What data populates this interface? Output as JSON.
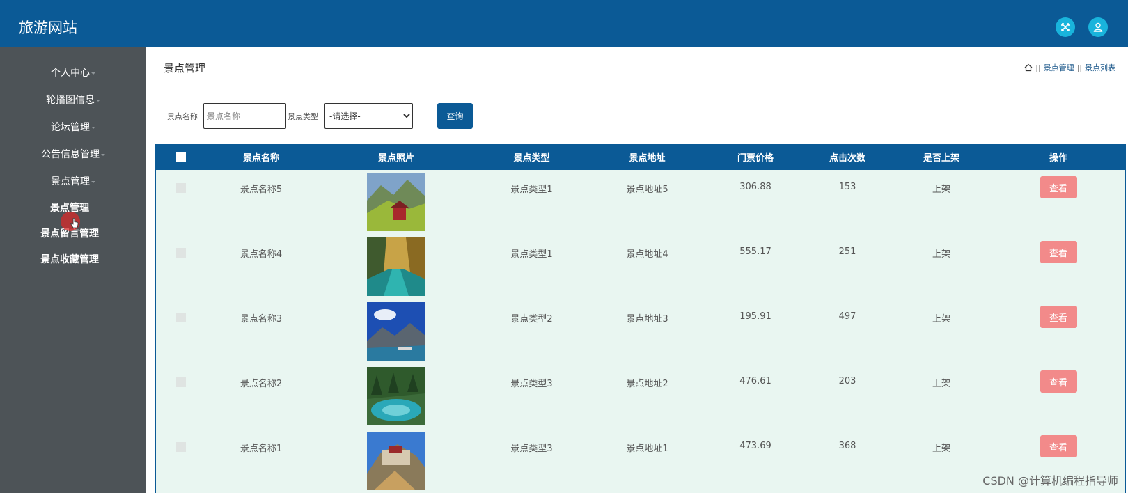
{
  "app": {
    "title": "旅游网站"
  },
  "header": {
    "fullscreen_icon": "fullscreen-icon",
    "user_icon": "user-icon"
  },
  "sidebar": {
    "items": [
      {
        "label": "个人中心"
      },
      {
        "label": "轮播图信息"
      },
      {
        "label": "论坛管理"
      },
      {
        "label": "公告信息管理"
      },
      {
        "label": "景点管理"
      }
    ],
    "sub_items": [
      {
        "label": "景点管理"
      },
      {
        "label": "景点留言管理"
      },
      {
        "label": "景点收藏管理"
      }
    ]
  },
  "page": {
    "title": "景点管理",
    "breadcrumb": [
      "景点管理",
      "景点列表"
    ]
  },
  "search": {
    "name_label": "景点名称",
    "name_placeholder": "景点名称",
    "type_label": "景点类型",
    "type_selected": "-请选择-",
    "query_label": "查询"
  },
  "table": {
    "headers": [
      "景点名称",
      "景点照片",
      "景点类型",
      "景点地址",
      "门票价格",
      "点击次数",
      "是否上架",
      "操作"
    ],
    "rows": [
      {
        "name": "景点名称5",
        "type": "景点类型1",
        "address": "景点地址5",
        "price": "306.88",
        "clicks": "153",
        "status": "上架",
        "action": "查看"
      },
      {
        "name": "景点名称4",
        "type": "景点类型1",
        "address": "景点地址4",
        "price": "555.17",
        "clicks": "251",
        "status": "上架",
        "action": "查看"
      },
      {
        "name": "景点名称3",
        "type": "景点类型2",
        "address": "景点地址3",
        "price": "195.91",
        "clicks": "497",
        "status": "上架",
        "action": "查看"
      },
      {
        "name": "景点名称2",
        "type": "景点类型3",
        "address": "景点地址2",
        "price": "476.61",
        "clicks": "203",
        "status": "上架",
        "action": "查看"
      },
      {
        "name": "景点名称1",
        "type": "景点类型3",
        "address": "景点地址1",
        "price": "473.69",
        "clicks": "368",
        "status": "上架",
        "action": "查看"
      }
    ]
  },
  "watermark": "CSDN @计算机编程指导师",
  "colors": {
    "primary": "#0b5a96",
    "sidebar": "#4d5357",
    "accent": "#19b4dc",
    "view_button": "#f28a8a",
    "table_bg": "#e9f6f1"
  }
}
